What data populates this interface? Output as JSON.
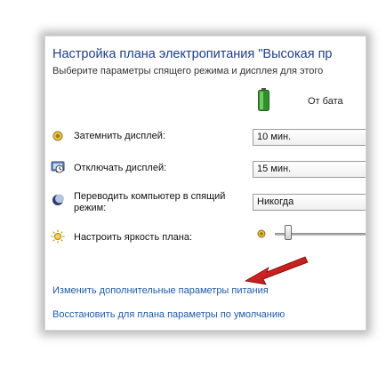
{
  "window": {
    "title": "Настройка плана электропитания \"Высокая пр",
    "subtitle": "Выберите параметры спящего режима и дисплея для этого"
  },
  "columns": {
    "battery_label": "От бата"
  },
  "settings": [
    {
      "label": "Затемнить дисплей:",
      "value": "10 мин."
    },
    {
      "label": "Отключать дисплей:",
      "value": "15 мин."
    },
    {
      "label": "Переводить компьютер в спящий режим:",
      "value": "Никогда"
    },
    {
      "label": "Настроить яркость плана:"
    }
  ],
  "brightness": {
    "level": 0.1
  },
  "links": {
    "advanced": "Изменить дополнительные параметры питания",
    "restore": "Восстановить для плана параметры по умолчанию"
  },
  "icons": {
    "battery": "battery-icon",
    "dim": "dim-display-icon",
    "display_off": "display-off-icon",
    "sleep": "sleep-moon-icon",
    "brightness": "sun-icon"
  },
  "colors": {
    "title": "#1e3f86",
    "link": "#1e5aa8",
    "arrow": "#d01818",
    "battery": "#3aa32f"
  }
}
